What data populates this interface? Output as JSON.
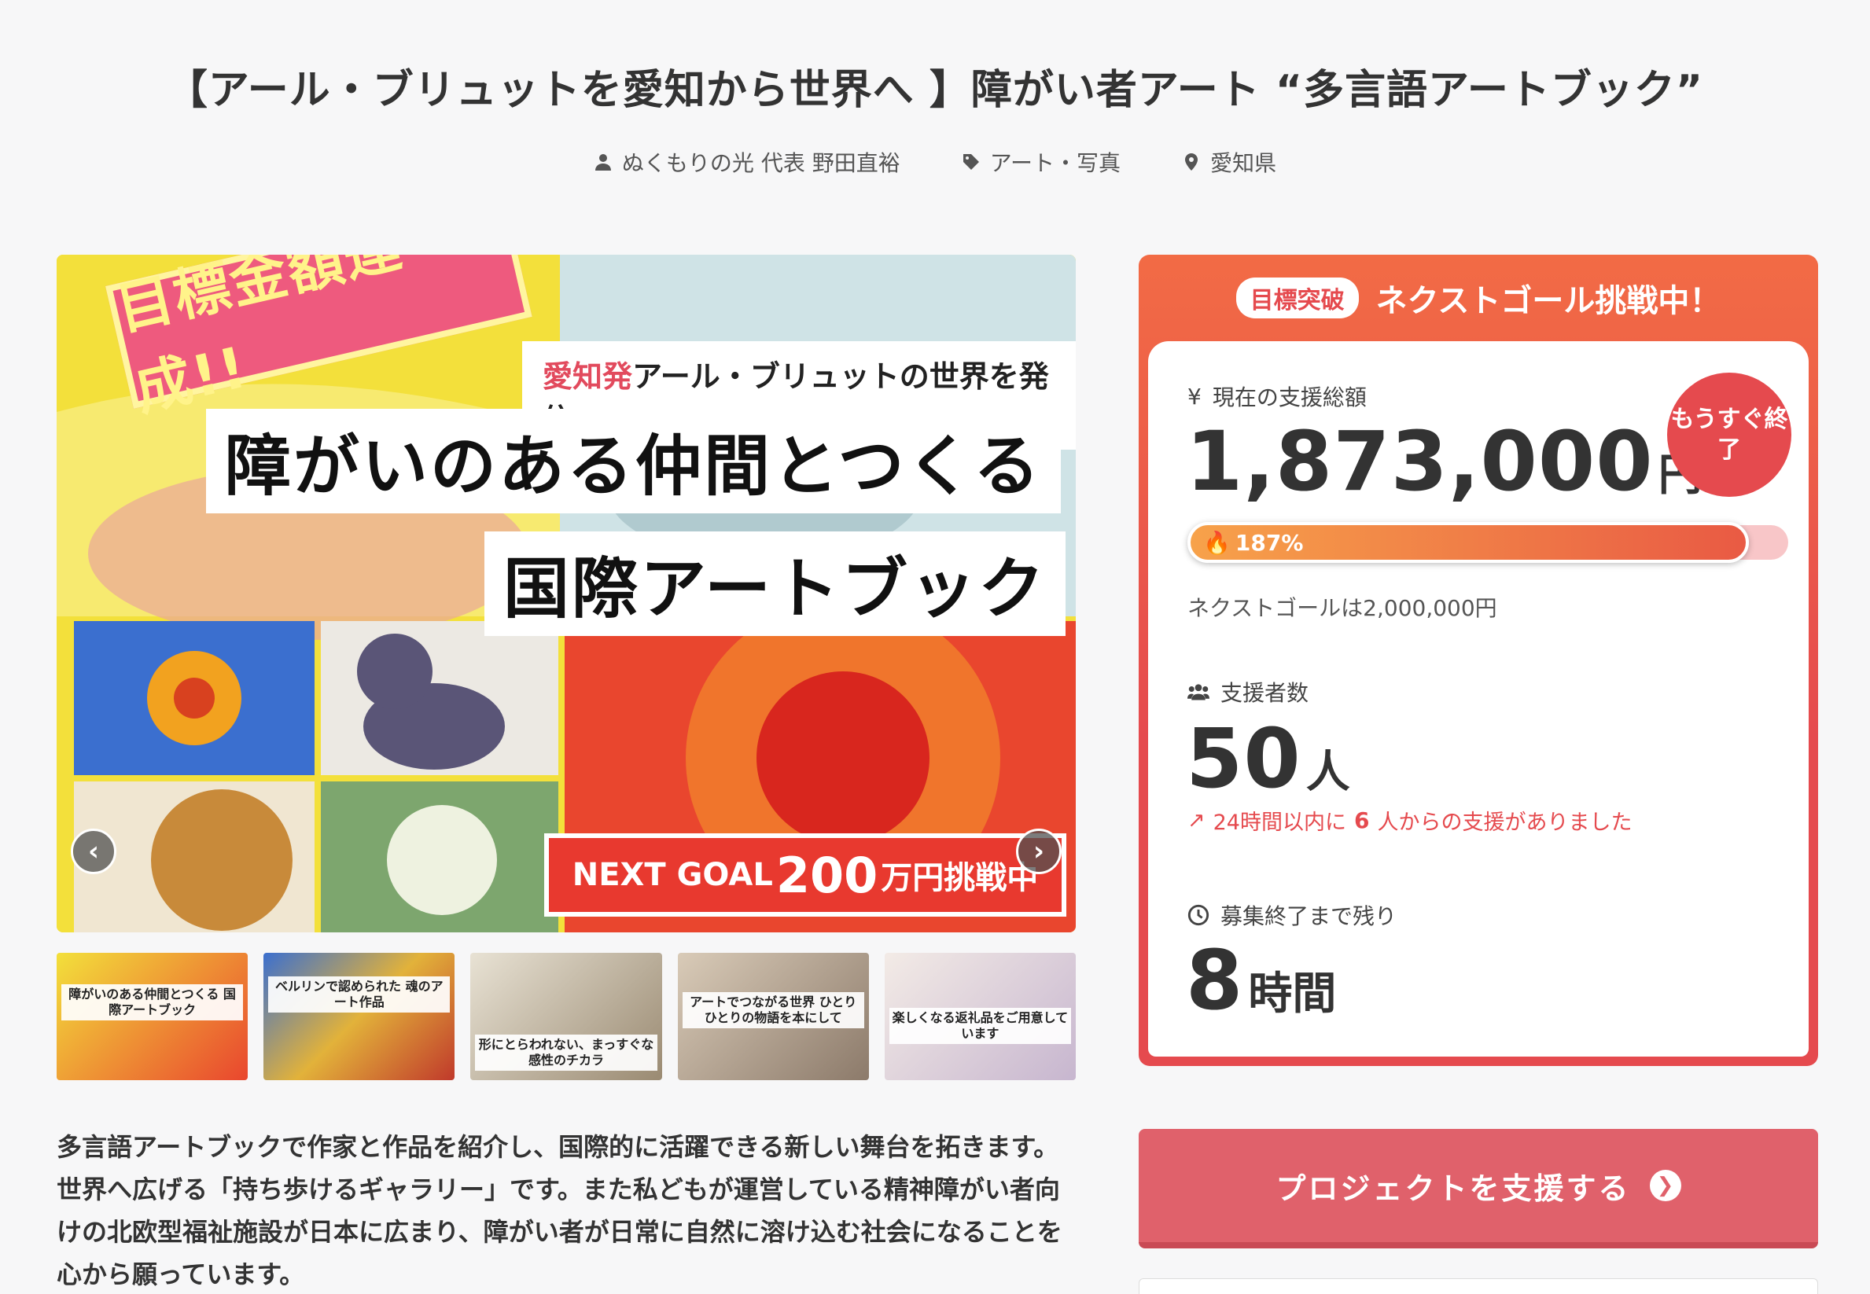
{
  "project": {
    "title": "【アール・ブリュットを愛知から世界へ 】障がい者アート “多言語アートブック”",
    "owner": "ぬくもりの光 代表 野田直裕",
    "category": "アート・写真",
    "location": "愛知県"
  },
  "hero": {
    "ribbon": "目標金額達成!!",
    "sub_red": "愛知発",
    "sub_rest": "アール・ブリュットの世界を発信",
    "line1": "障がいのある仲間とつくる",
    "line2": "国際アートブック",
    "next_goal_prefix": "NEXT GOAL",
    "next_goal_amount": "200",
    "next_goal_suffix": "万円挑戦中",
    "prev_label": "‹",
    "next_label": "›"
  },
  "thumbnails": [
    {
      "caption": "障がいのある仲間とつくる 国際アートブック"
    },
    {
      "caption": "ベルリンで認められた 魂のアート作品"
    },
    {
      "caption": "形にとらわれない、まっすぐな感性のチカラ"
    },
    {
      "caption": "アートでつながる世界 ひとりひとりの物語を本にして"
    },
    {
      "caption": "楽しくなる返礼品をご用意しています"
    }
  ],
  "description": "多言語アートブックで作家と作品を紹介し、国際的に活躍できる新しい舞台を拓きます。世界へ広げる「持ち歩けるギャラリー」です。また私どもが運営している精神障がい者向けの北欧型福祉施設が日本に広まり、障がい者が日常に自然に溶け込む社会になることを心から願っています。",
  "panel": {
    "badge": "目標突破",
    "heading": "ネクストゴール挑戦中！",
    "total_label": "現在の支援総額",
    "total_amount": "1,873,000",
    "total_unit": "円",
    "ending_soon": "もうすぐ終了",
    "progress_percent": 187,
    "progress_label": "187%",
    "progress_fill_fraction": 0.935,
    "next_goal_text": "ネクストゴールは2,000,000円",
    "backers_label": "支援者数",
    "backers_count": "50",
    "backers_unit": "人",
    "recent_prefix": "24時間以内に",
    "recent_count": "6",
    "recent_suffix": "人からの支援がありました",
    "remaining_label": "募集終了まで残り",
    "remaining_value": "8",
    "remaining_unit": "時間"
  },
  "cta": {
    "label": "プロジェクトを支援する"
  },
  "colors": {
    "accent": "#e54a4e",
    "cta": "#e0616b",
    "progress_start": "#f7a24a",
    "progress_end": "#e95a44"
  }
}
